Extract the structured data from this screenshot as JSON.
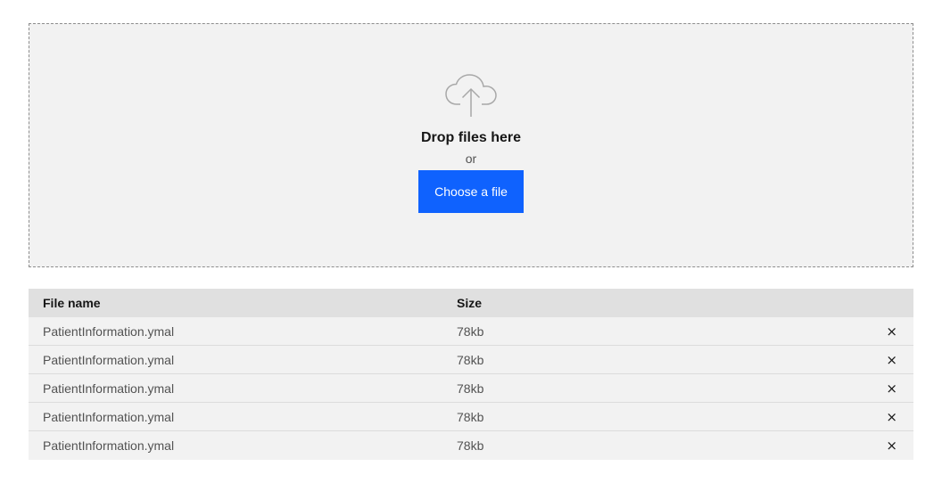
{
  "uploader": {
    "icon": "cloud-upload-icon",
    "title": "Drop files here",
    "or_text": "or",
    "button_label": "Choose a file"
  },
  "table": {
    "headers": {
      "name": "File name",
      "size": "Size"
    },
    "rows": [
      {
        "name": "PatientInformation.ymal",
        "size": "78kb",
        "remove_icon": "×"
      },
      {
        "name": "PatientInformation.ymal",
        "size": "78kb",
        "remove_icon": "×"
      },
      {
        "name": "PatientInformation.ymal",
        "size": "78kb",
        "remove_icon": "×"
      },
      {
        "name": "PatientInformation.ymal",
        "size": "78kb",
        "remove_icon": "×"
      },
      {
        "name": "PatientInformation.ymal",
        "size": "78kb",
        "remove_icon": "×"
      }
    ]
  },
  "colors": {
    "accent": "#0f62fe",
    "dropzone_bg": "#f2f2f2",
    "header_bg": "#e0e0e0"
  }
}
